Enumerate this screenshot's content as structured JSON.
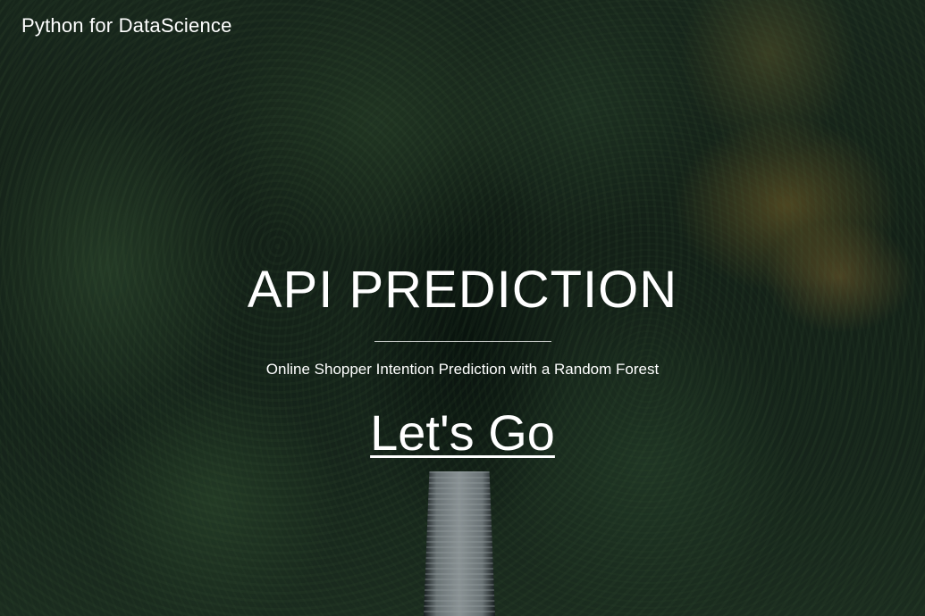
{
  "header": {
    "brand": "Python for DataScience"
  },
  "hero": {
    "title": "API PREDICTION",
    "subtitle": "Online Shopper Intention Prediction with a Random Forest",
    "cta_label": "Let's Go"
  }
}
